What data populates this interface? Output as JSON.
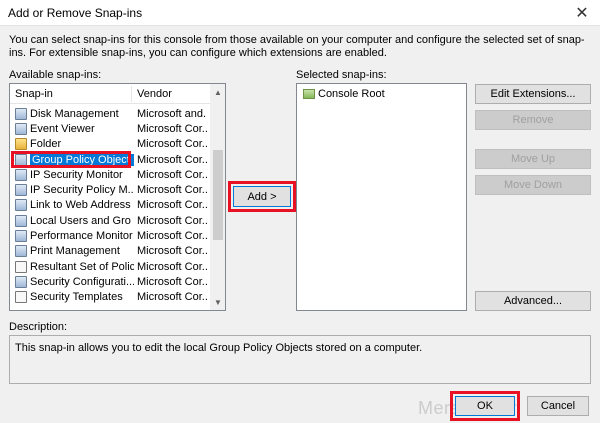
{
  "window": {
    "title": "Add or Remove Snap-ins"
  },
  "intro": "You can select snap-ins for this console from those available on your computer and configure the selected set of snap-ins. For extensible snap-ins, you can configure which extensions are enabled.",
  "available": {
    "label": "Available snap-ins:",
    "columns": [
      "Snap-in",
      "Vendor"
    ],
    "rows": [
      {
        "name": "Disk Management",
        "vendor": "Microsoft and...",
        "icon": "disk-icon"
      },
      {
        "name": "Event Viewer",
        "vendor": "Microsoft Cor...",
        "icon": "event-viewer-icon"
      },
      {
        "name": "Folder",
        "vendor": "Microsoft Cor...",
        "icon": "folder-icon"
      },
      {
        "name": "Group Policy Object ...",
        "vendor": "Microsoft Cor...",
        "icon": "group-policy-icon"
      },
      {
        "name": "IP Security Monitor",
        "vendor": "Microsoft Cor...",
        "icon": "ip-security-icon"
      },
      {
        "name": "IP Security Policy M...",
        "vendor": "Microsoft Cor...",
        "icon": "ip-security-policy-icon"
      },
      {
        "name": "Link to Web Address",
        "vendor": "Microsoft Cor...",
        "icon": "web-link-icon"
      },
      {
        "name": "Local Users and Gro",
        "vendor": "Microsoft Cor...",
        "icon": "users-icon"
      },
      {
        "name": "Performance Monitor",
        "vendor": "Microsoft Cor...",
        "icon": "performance-icon"
      },
      {
        "name": "Print Management",
        "vendor": "Microsoft Cor...",
        "icon": "printer-icon"
      },
      {
        "name": "Resultant Set of Policy",
        "vendor": "Microsoft Cor...",
        "icon": "policy-icon"
      },
      {
        "name": "Security Configurati...",
        "vendor": "Microsoft Cor...",
        "icon": "security-config-icon"
      },
      {
        "name": "Security Templates",
        "vendor": "Microsoft Cor...",
        "icon": "security-templates-icon"
      }
    ]
  },
  "selected": {
    "label": "Selected snap-ins:",
    "items": [
      {
        "name": "Console Root",
        "icon": "console-root-icon"
      }
    ]
  },
  "buttons": {
    "add": "Add >",
    "edit_extensions": "Edit Extensions...",
    "remove": "Remove",
    "move_up": "Move Up",
    "move_down": "Move Down",
    "advanced": "Advanced...",
    "ok": "OK",
    "cancel": "Cancel"
  },
  "description": {
    "label": "Description:",
    "text": "This snap-in allows you to edit the local Group Policy Objects stored on a computer."
  },
  "watermark": "MeraSarkar",
  "colors": {
    "selection": "#0078d7",
    "highlight_box": "#e81123"
  }
}
